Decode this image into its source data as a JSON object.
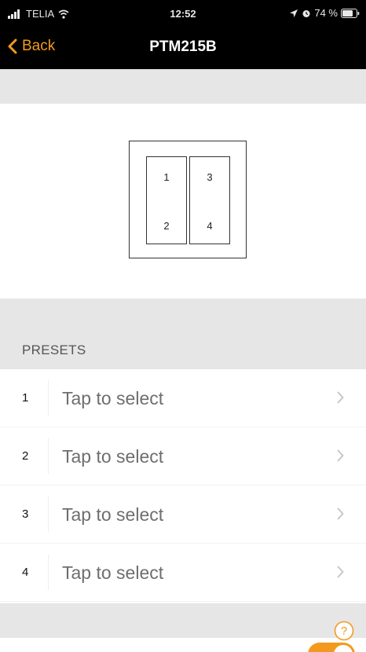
{
  "status_bar": {
    "carrier": "TELIA",
    "time": "12:52",
    "battery": "74 %",
    "icons": [
      "signal-icon",
      "wifi-icon",
      "location-icon",
      "alarm-icon",
      "battery-icon"
    ]
  },
  "nav": {
    "back_label": "Back",
    "title": "PTM215B"
  },
  "device": {
    "buttons": [
      "1",
      "2",
      "3",
      "4"
    ]
  },
  "presets": {
    "header": "PRESETS",
    "items": [
      {
        "number": "1",
        "label": "Tap to select"
      },
      {
        "number": "2",
        "label": "Tap to select"
      },
      {
        "number": "3",
        "label": "Tap to select"
      },
      {
        "number": "4",
        "label": "Tap to select"
      }
    ]
  },
  "help": {
    "icon": "help-icon",
    "glyph": "?"
  },
  "toggle": {
    "on": true
  },
  "colors": {
    "accent": "#f39a1e",
    "nav_background": "#000000",
    "band": "#e6e6e6"
  }
}
